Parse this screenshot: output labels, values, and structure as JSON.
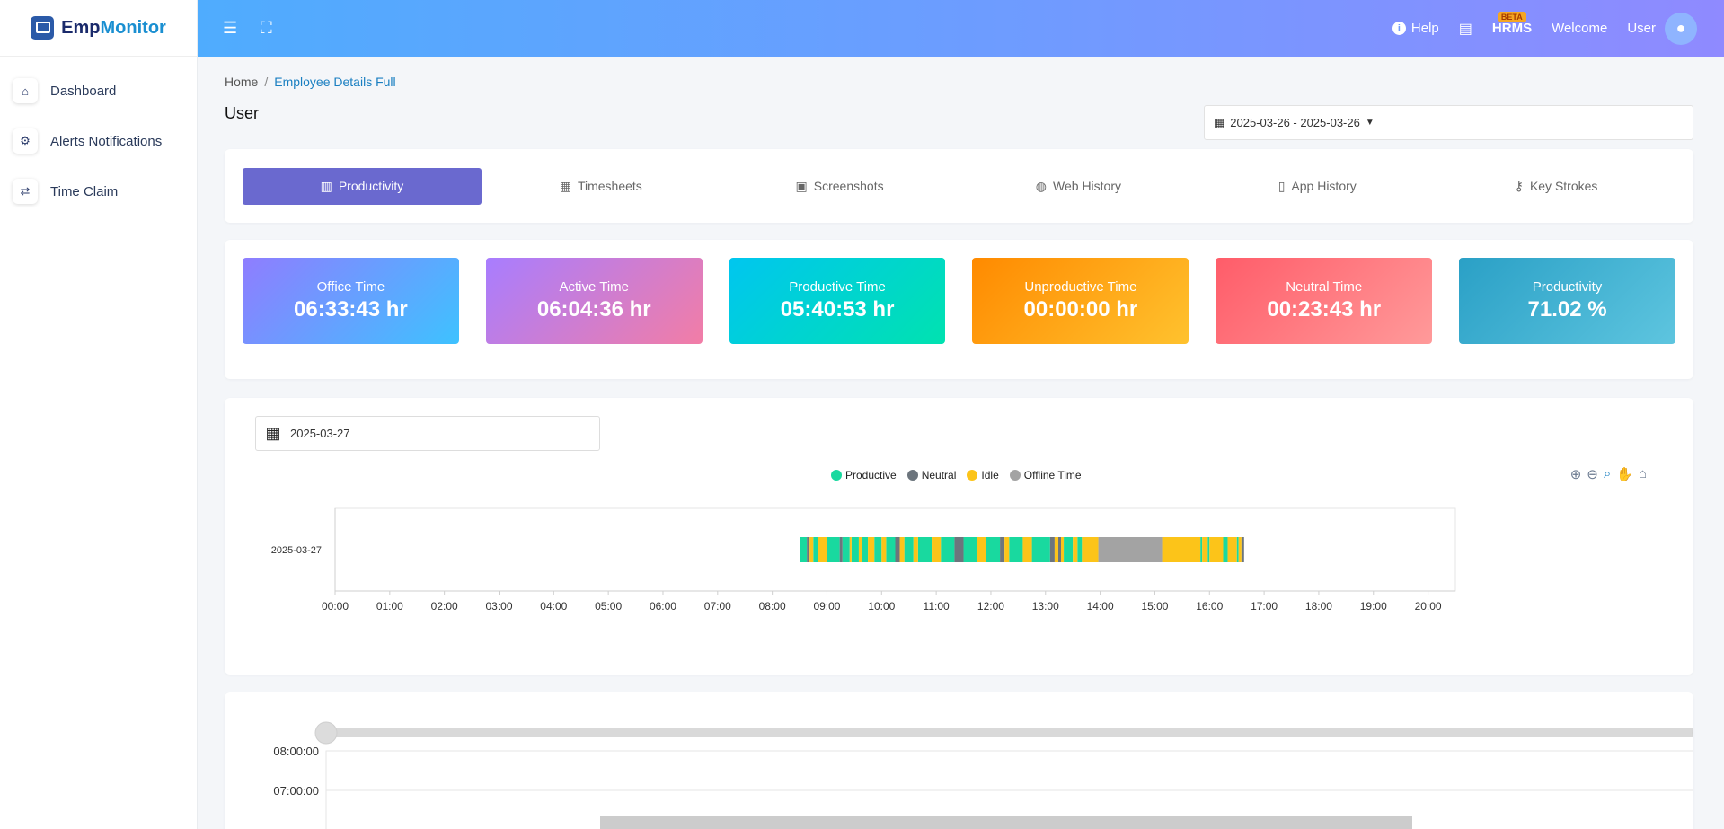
{
  "brand": {
    "name_part1": "Emp",
    "name_part2": "Monitor"
  },
  "sidebar": {
    "items": [
      {
        "label": "Dashboard",
        "icon": "home-icon"
      },
      {
        "label": "Alerts Notifications",
        "icon": "user-gear-icon"
      },
      {
        "label": "Time Claim",
        "icon": "exchange-icon"
      }
    ]
  },
  "header": {
    "help": "Help",
    "hrms": "HRMS",
    "beta": "BETA",
    "welcome": "Welcome",
    "user": "User"
  },
  "breadcrumb": {
    "home": "Home",
    "current": "Employee Details Full"
  },
  "page": {
    "title": "User",
    "date_range": "2025-03-26 - 2025-03-26"
  },
  "tabs": [
    {
      "label": "Productivity",
      "icon": "bar-chart-icon",
      "active": true
    },
    {
      "label": "Timesheets",
      "icon": "calendar-icon"
    },
    {
      "label": "Screenshots",
      "icon": "images-icon"
    },
    {
      "label": "Web History",
      "icon": "globe-icon"
    },
    {
      "label": "App History",
      "icon": "mobile-icon"
    },
    {
      "label": "Key Strokes",
      "icon": "key-icon"
    }
  ],
  "stats": [
    {
      "label": "Office Time",
      "value": "06:33:43 hr",
      "grad": [
        "#8f7dff",
        "#3ec2ff"
      ]
    },
    {
      "label": "Active Time",
      "value": "06:04:36 hr",
      "grad": [
        "#a87dff",
        "#f27da6"
      ]
    },
    {
      "label": "Productive Time",
      "value": "05:40:53 hr",
      "grad": [
        "#00c6ef",
        "#00e2b0"
      ]
    },
    {
      "label": "Unproductive Time",
      "value": "00:00:00 hr",
      "grad": [
        "#ff8a00",
        "#ffc22e"
      ]
    },
    {
      "label": "Neutral Time",
      "value": "00:23:43 hr",
      "grad": [
        "#ff5c69",
        "#ff9a9a"
      ]
    },
    {
      "label": "Productivity",
      "value": "71.02 %",
      "grad": [
        "#2aa0c6",
        "#5ec5df"
      ]
    }
  ],
  "timeline": {
    "date": "2025-03-27",
    "legend": [
      {
        "name": "Productive",
        "color": "#19d99f"
      },
      {
        "name": "Neutral",
        "color": "#6c757d"
      },
      {
        "name": "Idle",
        "color": "#fcc419"
      },
      {
        "name": "Offline Time",
        "color": "#a3a3a3"
      }
    ]
  },
  "chart_data": [
    {
      "type": "bar",
      "title": "",
      "categories": [
        "2025-03-27"
      ],
      "x_ticks": [
        "00:00",
        "01:00",
        "02:00",
        "03:00",
        "04:00",
        "05:00",
        "06:00",
        "07:00",
        "08:00",
        "09:00",
        "10:00",
        "11:00",
        "12:00",
        "13:00",
        "14:00",
        "15:00",
        "16:00",
        "17:00",
        "18:00",
        "19:00",
        "20:00"
      ],
      "xlim": [
        "00:00",
        "20:30"
      ],
      "series": [
        {
          "name": "Productive",
          "intervals": [
            [
              "08:30",
              "08:38"
            ],
            [
              "08:45",
              "08:50"
            ],
            [
              "09:00",
              "09:14"
            ],
            [
              "09:17",
              "09:25"
            ],
            [
              "09:27",
              "09:35"
            ],
            [
              "09:38",
              "09:45"
            ],
            [
              "09:52",
              "10:00"
            ],
            [
              "10:05",
              "10:15"
            ],
            [
              "10:25",
              "10:35"
            ],
            [
              "10:40",
              "10:55"
            ],
            [
              "11:05",
              "11:20"
            ],
            [
              "11:30",
              "11:45"
            ],
            [
              "11:55",
              "12:10"
            ],
            [
              "12:20",
              "12:35"
            ],
            [
              "12:45",
              "13:05"
            ],
            [
              "13:20",
              "13:30"
            ],
            [
              "13:35",
              "13:40"
            ],
            [
              "15:50",
              "15:52"
            ],
            [
              "15:58",
              "16:00"
            ],
            [
              "16:15",
              "16:20"
            ],
            [
              "16:30",
              "16:32"
            ]
          ]
        },
        {
          "name": "Neutral",
          "intervals": [
            [
              "08:38",
              "08:41"
            ],
            [
              "09:14",
              "09:17"
            ],
            [
              "10:15",
              "10:20"
            ],
            [
              "11:20",
              "11:30"
            ],
            [
              "12:10",
              "12:15"
            ],
            [
              "13:05",
              "13:10"
            ],
            [
              "13:14",
              "13:17"
            ],
            [
              "16:35",
              "16:38"
            ]
          ]
        },
        {
          "name": "Idle",
          "intervals": [
            [
              "08:41",
              "08:45"
            ],
            [
              "08:50",
              "09:00"
            ],
            [
              "09:25",
              "09:27"
            ],
            [
              "09:35",
              "09:38"
            ],
            [
              "09:45",
              "09:52"
            ],
            [
              "10:00",
              "10:05"
            ],
            [
              "10:20",
              "10:25"
            ],
            [
              "10:35",
              "10:40"
            ],
            [
              "10:55",
              "11:05"
            ],
            [
              "11:45",
              "11:55"
            ],
            [
              "12:15",
              "12:20"
            ],
            [
              "12:35",
              "12:45"
            ],
            [
              "13:10",
              "13:14"
            ],
            [
              "13:17",
              "13:20"
            ],
            [
              "13:30",
              "13:35"
            ],
            [
              "13:40",
              "13:58"
            ],
            [
              "15:08",
              "15:50"
            ],
            [
              "15:52",
              "15:58"
            ],
            [
              "16:00",
              "16:15"
            ],
            [
              "16:20",
              "16:30"
            ],
            [
              "16:32",
              "16:35"
            ]
          ]
        },
        {
          "name": "Offline Time",
          "intervals": [
            [
              "13:58",
              "15:08"
            ]
          ]
        }
      ]
    },
    {
      "type": "bar",
      "title": "",
      "y_ticks": [
        "08:00:00",
        "07:00:00"
      ],
      "range": {
        "start": 0,
        "end": 1
      },
      "values": []
    }
  ]
}
